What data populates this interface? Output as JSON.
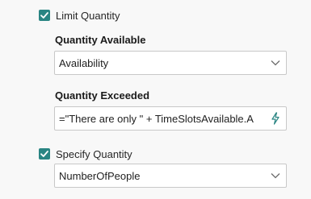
{
  "colors": {
    "accent": "#2a8583",
    "background": "#f8f8f8",
    "input_border": "#c8c8c8"
  },
  "limit_quantity": {
    "checked": true,
    "label": "Limit Quantity"
  },
  "quantity_available": {
    "label": "Quantity Available",
    "value": "Availability",
    "icon": "chevron-down-icon"
  },
  "quantity_exceeded": {
    "label": "Quantity Exceeded",
    "value": "=\"There are only \" + TimeSlotsAvailable.A",
    "icon": "lightning-icon"
  },
  "specify_quantity": {
    "checked": true,
    "label": "Specify Quantity"
  },
  "quantity_field": {
    "value": "NumberOfPeople",
    "icon": "chevron-down-icon"
  }
}
